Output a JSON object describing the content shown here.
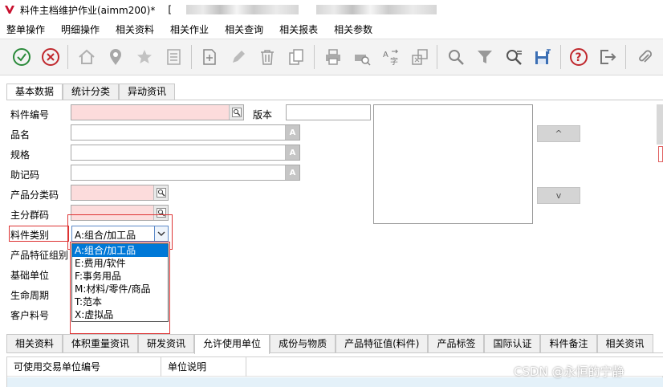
{
  "window": {
    "title": "料件主档维护作业(aimm200)*",
    "title_prefix": "["
  },
  "menubar": [
    "整单操作",
    "明细操作",
    "相关资料",
    "相关作业",
    "相关查询",
    "相关报表",
    "相关参数"
  ],
  "toolbar": {
    "icons": [
      "check-circle-icon",
      "cancel-circle-icon",
      "home-icon",
      "location-pin-icon",
      "star-icon",
      "list-icon",
      "new-document-icon",
      "pencil-icon",
      "trash-icon",
      "copy-icon",
      "print-icon",
      "print-preview-icon",
      "translate-icon",
      "export-icon",
      "search-icon",
      "filter-icon",
      "advanced-search-icon",
      "save-icon",
      "help-icon",
      "exit-icon",
      "attachment-icon"
    ]
  },
  "tabs_top": [
    "基本数据",
    "统计分类",
    "异动资讯"
  ],
  "form": {
    "item_no_label": "料件编号",
    "version_label": "版本",
    "name_label": "品名",
    "spec_label": "规格",
    "mnemonic_label": "助记码",
    "product_class_label": "产品分类码",
    "main_group_label": "主分群码",
    "item_type_label": "料件类别",
    "product_feature_label": "产品特征组别",
    "base_unit_label": "基础单位",
    "lifecycle_label": "生命周期",
    "customer_no_label": "客户料号",
    "item_type_value": "A:组合/加工品",
    "lookup_icon_text": "A"
  },
  "dropdown": {
    "options": [
      "A:组合/加工品",
      "E:费用/软件",
      "F:事务用品",
      "M:材料/零件/商品",
      "T:范本",
      "X:虚拟品"
    ],
    "selected_index": 0
  },
  "nav": {
    "up": "^",
    "down": "v"
  },
  "tabs_bottom": [
    "相关资料",
    "体积重量资讯",
    "研发资讯",
    "允许使用单位",
    "成份与物质",
    "产品特征值(料件)",
    "产品标签",
    "国际认证",
    "料件备注",
    "相关资讯"
  ],
  "tabs_bottom_active": 3,
  "grid": {
    "columns": [
      "可使用交易单位编号",
      "单位说明"
    ]
  },
  "watermark": "CSDN @永恒的宁静"
}
